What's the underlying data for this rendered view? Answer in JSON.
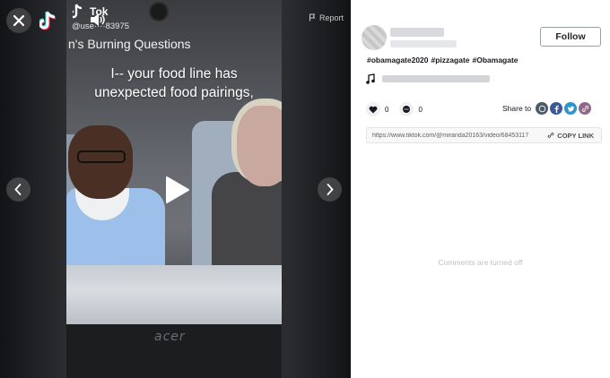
{
  "video": {
    "close_icon": "close-icon",
    "handle": "@use····83975",
    "brand": "Tok",
    "title_text": "n's Burning Questions",
    "caption_line1": "I-- your food line has",
    "caption_line2": "unexpected food pairings,",
    "laptop_brand": "acer",
    "report_label": "Report",
    "colors": {
      "pane_bg": "#1b1c1e",
      "accent_white": "#ffffff"
    }
  },
  "info": {
    "follow_label": "Follow",
    "hashtags": [
      "#obamagate2020",
      "#pizzagate",
      "#Obamagate"
    ],
    "likes": "0",
    "comments": "0",
    "share_label": "Share to",
    "share_targets": [
      "whatsapp-icon",
      "facebook-icon",
      "twitter-icon",
      "link-icon"
    ],
    "share_colors": [
      "#4b5a66",
      "#3b5998",
      "#2d95c9",
      "#8e6a8a"
    ],
    "video_url": "https://www.tiktok.com/@miranda20163/video/68453117",
    "copy_link_label": "COPY LINK",
    "comments_off": "Comments are turned off"
  }
}
